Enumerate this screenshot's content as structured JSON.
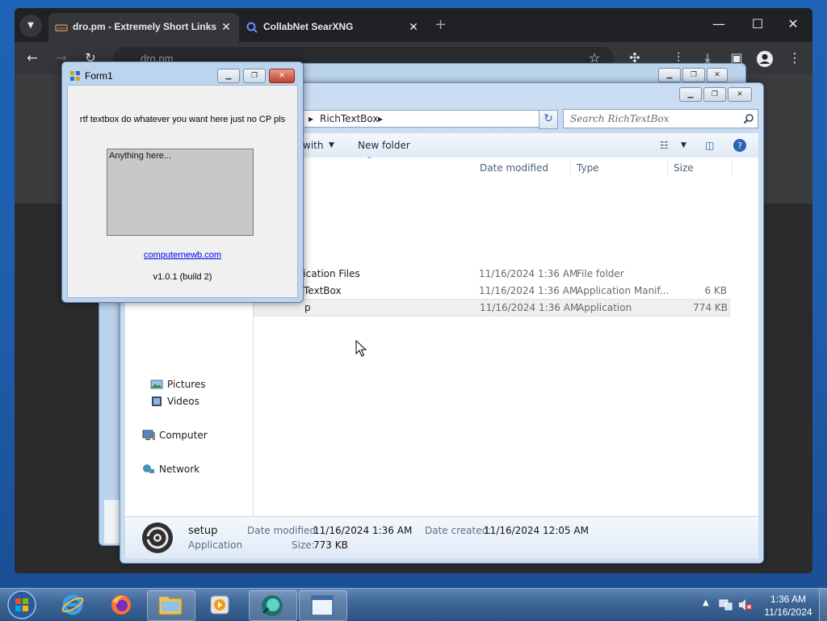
{
  "browser": {
    "tabs": [
      {
        "title": "dro.pm - Extremely Short Links",
        "active": true
      },
      {
        "title": "CollabNet SearXNG",
        "active": false
      }
    ],
    "address": "dro.pm",
    "new_tab_symbol": "+",
    "close_symbol": "✕"
  },
  "explorer": {
    "breadcrumb_current": "RichTextBox",
    "search_placeholder": "Search RichTextBox",
    "cmd_open_with": "with",
    "cmd_new_folder": "New folder",
    "columns": {
      "date": "Date modified",
      "type": "Type",
      "size": "Size"
    },
    "rows": [
      {
        "name": "lication Files",
        "date": "11/16/2024 1:36 AM",
        "type": "File folder",
        "size": ""
      },
      {
        "name": "TextBox",
        "date": "11/16/2024 1:36 AM",
        "type": "Application Manif...",
        "size": "6 KB"
      },
      {
        "name": "p",
        "date": "11/16/2024 1:36 AM",
        "type": "Application",
        "size": "774 KB"
      }
    ],
    "nav": {
      "pictures": "Pictures",
      "videos": "Videos",
      "computer": "Computer",
      "network": "Network"
    },
    "details": {
      "name": "setup",
      "kind": "Application",
      "date_modified_label": "Date modified:",
      "date_modified": "11/16/2024 1:36 AM",
      "date_created_label": "Date created:",
      "date_created": "11/16/2024 12:05 AM",
      "size_label": "Size:",
      "size": "773 KB"
    }
  },
  "form1": {
    "title": "Form1",
    "label": "rtf textbox do whatever you want here just no CP pls",
    "rtb_text": "Anything here...",
    "link": "computernewb.com",
    "version": "v1.0.1 (build 2)"
  },
  "taskbar": {
    "time": "1:36 AM",
    "date": "11/16/2024"
  },
  "colors": {
    "chrome_bg": "#202124",
    "accent_link": "#0000ee",
    "taskbar": "#2b5484"
  }
}
